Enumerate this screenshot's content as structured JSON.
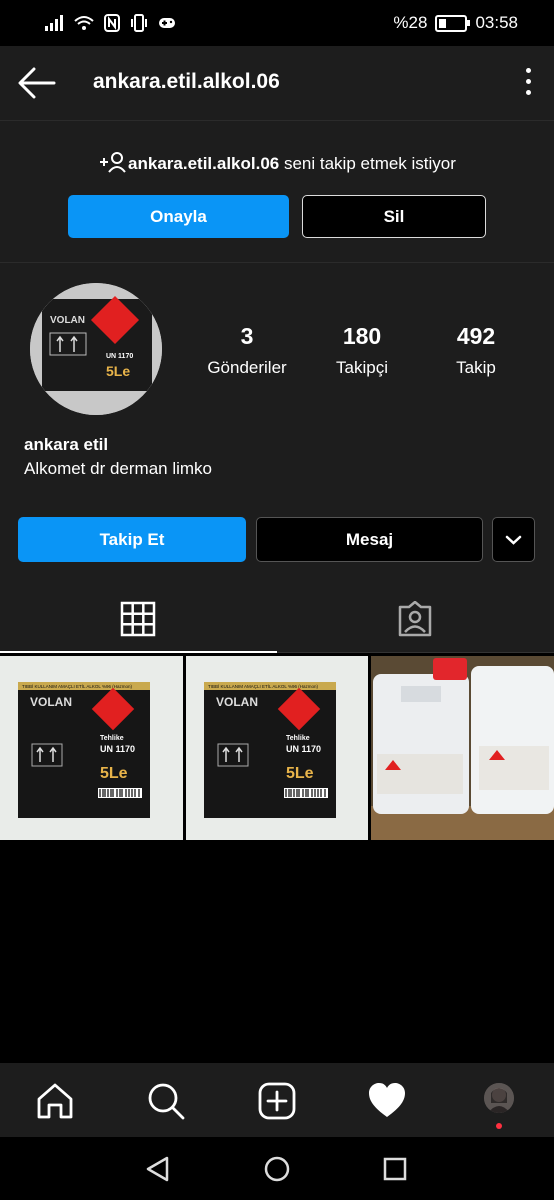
{
  "status_bar": {
    "battery_label": "%28",
    "battery_level_percent": 28,
    "time": "03:58"
  },
  "header": {
    "username": "ankara.etil.alkol.06"
  },
  "follow_request": {
    "username": "ankara.etil.alkol.06",
    "message": " seni takip etmek istiyor",
    "approve_label": "Onayla",
    "delete_label": "Sil"
  },
  "profile": {
    "stats": [
      {
        "value": "3",
        "label": "Gönderiler"
      },
      {
        "value": "180",
        "label": "Takipçi"
      },
      {
        "value": "492",
        "label": "Takip"
      }
    ],
    "name": "ankara etil",
    "bio": "Alkomet  dr derman limko",
    "follow_label": "Takip Et",
    "message_label": "Mesaj"
  },
  "avatar_image": {
    "brand": "VOLAN",
    "un_code": "UN 1170",
    "volume": "5Le"
  },
  "posts": [
    {
      "brand": "VOLAN",
      "header": "TIBBİ KULLANIM AMAÇLI ETİL ALKOL %96 (Hazmon)",
      "warning": "Tehlike",
      "un_code": "UN 1170",
      "volume": "5Le"
    },
    {
      "brand": "VOLAN",
      "header": "TIBBİ KULLANIM AMAÇLI ETİL ALKOL %96 (Hazmon)",
      "warning": "Tehlike",
      "un_code": "UN 1170",
      "volume": "5Le"
    },
    {
      "photo": "alcohol-canisters-red-caps"
    }
  ],
  "colors": {
    "accent": "#0a95f6",
    "panel": "#1d1d1d",
    "background": "#000000"
  }
}
